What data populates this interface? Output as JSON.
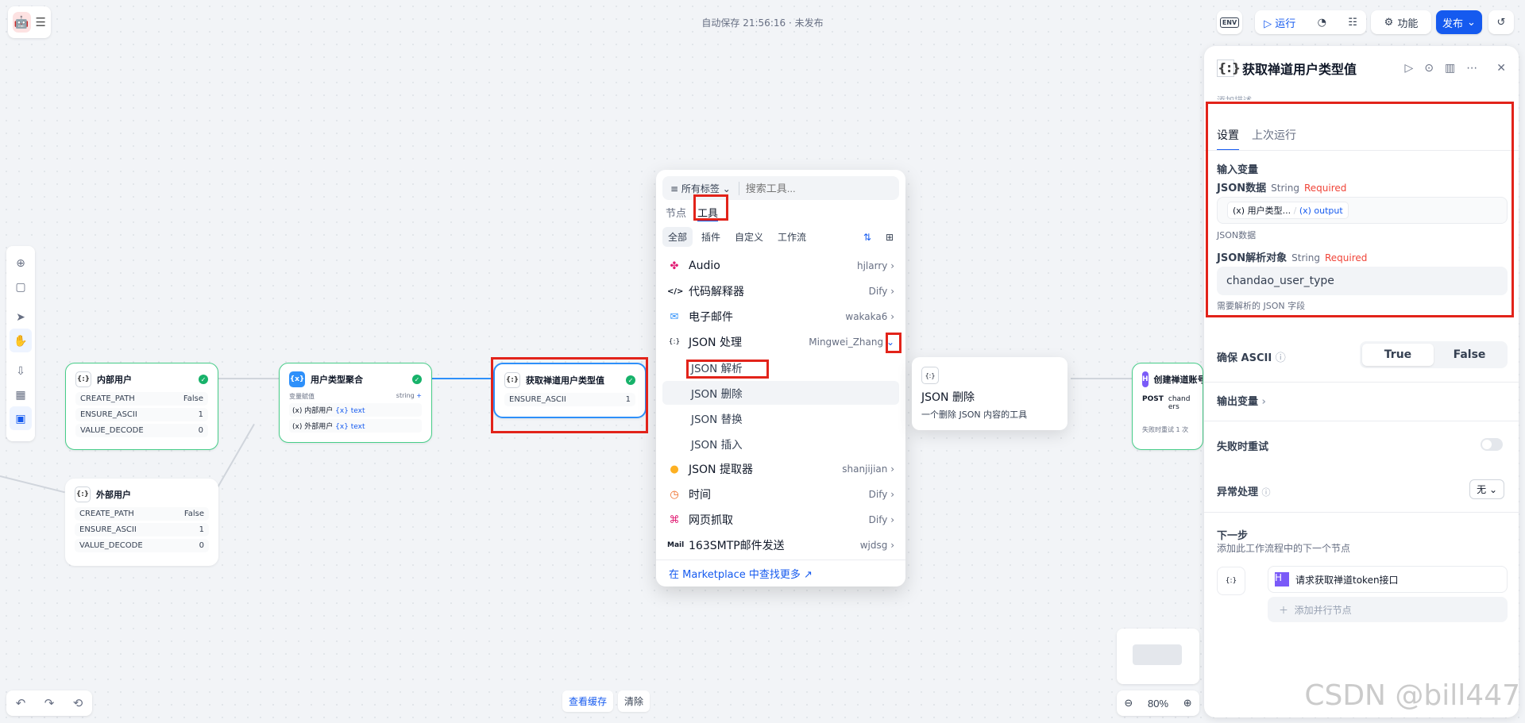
{
  "header": {
    "autosave": "自动保存 21:56:16 · 未发布",
    "env_label": "ENV",
    "run_label": "运行",
    "features_label": "功能",
    "publish_label": "发布"
  },
  "nodes": {
    "internal": {
      "title": "内部用户",
      "rows": [
        {
          "k": "CREATE_PATH",
          "v": "False"
        },
        {
          "k": "ENSURE_ASCII",
          "v": "1"
        },
        {
          "k": "VALUE_DECODE",
          "v": "0"
        }
      ]
    },
    "external": {
      "title": "外部用户",
      "rows": [
        {
          "k": "CREATE_PATH",
          "v": "False"
        },
        {
          "k": "ENSURE_ASCII",
          "v": "1"
        },
        {
          "k": "VALUE_DECODE",
          "v": "0"
        }
      ]
    },
    "aggregator": {
      "title": "用户类型聚合",
      "assign_label": "变量赋值",
      "type": "string",
      "var1": "(x) 内部用户",
      "var1_val": "{x} text",
      "var2": "(x) 外部用户",
      "var2_val": "{x} text"
    },
    "getvalue": {
      "title": "获取禅道用户类型值",
      "row_k": "ENSURE_ASCII",
      "row_v": "1"
    },
    "create": {
      "title": "创建禅道账号",
      "method": "POST",
      "url": "chand ers",
      "retry": "失败时重试 1 次"
    }
  },
  "picker": {
    "filter_label": "所有标签",
    "search_placeholder": "搜索工具...",
    "tab_nodes": "节点",
    "tab_tools": "工具",
    "subtabs": [
      "全部",
      "插件",
      "自定义",
      "工作流"
    ],
    "items": [
      {
        "icon": "✤",
        "label": "Audio",
        "author": "hjlarry"
      },
      {
        "icon": "</>",
        "label": "代码解释器",
        "author": "Dify"
      },
      {
        "icon": "✉",
        "label": "电子邮件",
        "author": "wakaka6"
      },
      {
        "icon": "{:}",
        "label": "JSON 处理",
        "author": "Mingwei_Zhang"
      }
    ],
    "subitems": [
      "JSON 解析",
      "JSON 删除",
      "JSON 替换",
      "JSON 插入"
    ],
    "items2": [
      {
        "icon": "●",
        "label": "JSON 提取器",
        "author": "shanjijian"
      },
      {
        "icon": "◷",
        "label": "时间",
        "author": "Dify"
      },
      {
        "icon": "⌘",
        "label": "网页抓取",
        "author": "Dify"
      },
      {
        "icon": "Mail",
        "label": "163SMTP邮件发送",
        "author": "wjdsg"
      }
    ],
    "footer": "在 Marketplace 中查找更多 ↗"
  },
  "tooltip": {
    "icon": "{:}",
    "title": "JSON 删除",
    "desc": "一个删除 JSON 内容的工具"
  },
  "panel": {
    "title": "获取禅道用户类型值",
    "desc_placeholder": "添加描述...",
    "tab_settings": "设置",
    "tab_last_run": "上次运行",
    "input_vars": "输入变量",
    "json_data_label": "JSON数据",
    "json_data_type": "String",
    "required": "Required",
    "json_data_var": "(x) 用户类型...",
    "json_data_out": "(x) output",
    "json_data_hint": "JSON数据",
    "parse_obj_label": "JSON解析对象",
    "parse_obj_type": "String",
    "parse_obj_value": "chandao_user_type",
    "parse_obj_hint": "需要解析的 JSON 字段",
    "ensure_ascii": "确保 ASCII",
    "opt_true": "True",
    "opt_false": "False",
    "output_vars": "输出变量",
    "retry": "失败时重试",
    "error_handling": "异常处理",
    "error_value": "无",
    "next_step": "下一步",
    "next_hint": "添加此工作流程中的下一个节点",
    "next_node": "请求获取禅道token接口",
    "add_parallel": "添加并行节点"
  },
  "footer": {
    "view_cache": "查看缓存",
    "clear": "清除",
    "zoom": "80%"
  },
  "watermark": "CSDN @bill447"
}
